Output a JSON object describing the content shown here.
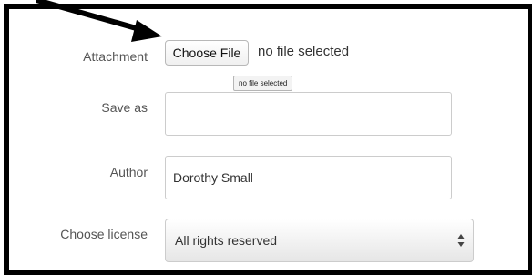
{
  "attachment": {
    "label": "Attachment",
    "button_label": "Choose File",
    "status_text": "no file selected",
    "tooltip_text": "no file selected"
  },
  "save_as": {
    "label": "Save as",
    "value": ""
  },
  "author": {
    "label": "Author",
    "value": "Dorothy Small"
  },
  "license": {
    "label": "Choose license",
    "selected": "All rights reserved"
  },
  "icons": {
    "annotation": "arrow-icon",
    "select": "updown-chevron-icon"
  },
  "colors": {
    "frame": "#000000",
    "label": "#555555",
    "input_border": "#cccccc"
  }
}
